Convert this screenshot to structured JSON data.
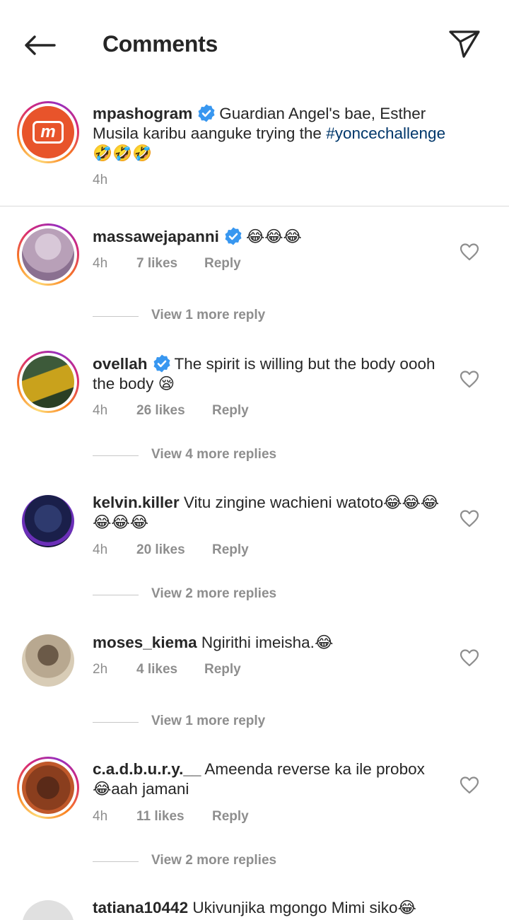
{
  "header": {
    "title": "Comments",
    "back_icon": "arrow-left-icon",
    "send_icon": "paper-plane-icon"
  },
  "caption": {
    "username": "mpashogram",
    "verified": true,
    "text_before": "Guardian Angel's bae, Esther Musila karibu aanguke trying the",
    "hashtag": "#yoncechallenge",
    "emojis": "🤣🤣🤣",
    "time": "4h",
    "avatar_logo": "m"
  },
  "comments": [
    {
      "username": "massawejapanni",
      "verified": true,
      "text": "",
      "emojis": "😂😂😂",
      "time": "4h",
      "likes": "7 likes",
      "reply": "Reply",
      "more_replies": "View 1 more reply",
      "story_ring": true
    },
    {
      "username": "ovellah",
      "verified": true,
      "text": "The spirit is willing but the body oooh the body",
      "emojis": "😪",
      "time": "4h",
      "likes": "26 likes",
      "reply": "Reply",
      "more_replies": "View 4 more replies",
      "story_ring": true
    },
    {
      "username": "kelvin.killer",
      "verified": false,
      "text": "Vitu zingine wachieni watoto",
      "emojis": "😂😂😂😂😂😂",
      "time": "4h",
      "likes": "20 likes",
      "reply": "Reply",
      "more_replies": "View 2 more replies",
      "story_ring": false
    },
    {
      "username": "moses_kiema",
      "verified": false,
      "text": "Ngirithi imeisha.",
      "emojis": "😂",
      "time": "2h",
      "likes": "4 likes",
      "reply": "Reply",
      "more_replies": "View 1 more reply",
      "story_ring": false
    },
    {
      "username": "c.a.d.b.u.r.y.__",
      "verified": false,
      "text": "Ameenda reverse ka ile probox",
      "emojis": "😂",
      "text_after": "aah jamani",
      "time": "4h",
      "likes": "11 likes",
      "reply": "Reply",
      "more_replies": "View 2 more replies",
      "story_ring": true
    },
    {
      "username": "tatiana10442",
      "verified": false,
      "text": "Ukivunjika mgongo Mimi siko",
      "emojis": "😂",
      "story_ring": false
    }
  ],
  "colors": {
    "verified": "#3897f0",
    "hashtag": "#00376b",
    "meta": "#8e8e8e",
    "logo_bg": "#e8542b"
  }
}
